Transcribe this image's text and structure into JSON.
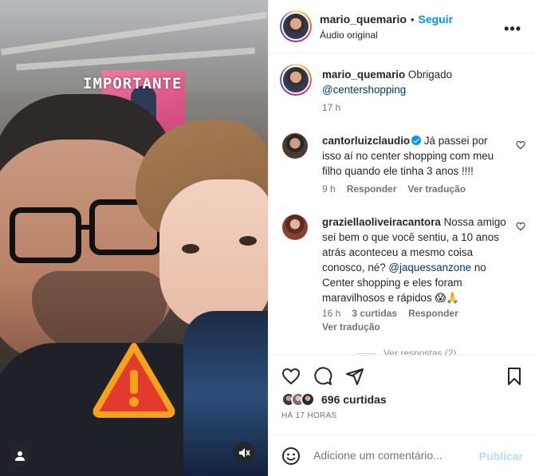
{
  "media": {
    "sticker_text": "IMPORTANTE",
    "icons": [
      "user-icon",
      "mute-icon",
      "warning-icon"
    ]
  },
  "post": {
    "author": "mario_quemario",
    "separator": "•",
    "follow_label": "Seguir",
    "audio_label": "Áudio original",
    "more_label": "•••"
  },
  "caption": {
    "username": "mario_quemario",
    "text": "Obrigado",
    "mention": "@centershopping",
    "time": "17 h"
  },
  "comments": [
    {
      "username": "cantorluizclaudio",
      "verified": true,
      "text": "Já passei por isso aí no center shopping com meu filho quando ele tinha 3 anos !!!!",
      "time": "9 h",
      "reply_label": "Responder",
      "translate_label": "Ver tradução"
    },
    {
      "username": "graziellaoliveiracantora",
      "verified": false,
      "text_before": "Nossa amigo sei bem o que você sentiu, a 10 anos atrás aconteceu a mesmo coisa conosco, né?",
      "mention": "@jaquessanzone",
      "text_after": "no Center shopping e eles foram maravilhosos e rápidos 😱🙏",
      "time": "16 h",
      "likes": "3 curtidas",
      "reply_label": "Responder",
      "translate_label": "Ver tradução"
    }
  ],
  "view_replies": "Ver respostas (2)",
  "likes": {
    "count_label": "696 curtidas",
    "time_ago": "HÁ 17 HORAS"
  },
  "composer": {
    "placeholder": "Adicione um comentário...",
    "publish_label": "Publicar"
  },
  "colors": {
    "accent": "#0095f6",
    "mention": "#00376b",
    "muted": "#737373",
    "publish_disabled": "#b2dffc",
    "warning_red": "#e23b2e",
    "warning_orange": "#f7a21b"
  }
}
